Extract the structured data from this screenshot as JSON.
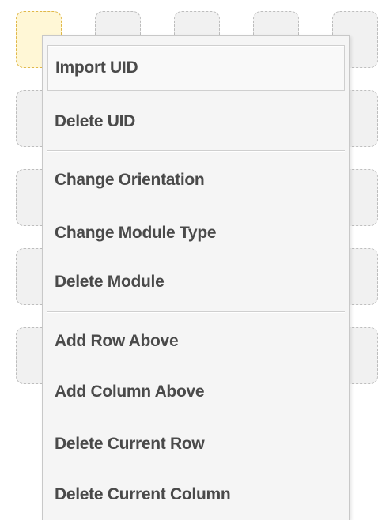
{
  "context_menu": {
    "items": [
      {
        "label": "Import UID"
      },
      {
        "label": "Delete UID"
      },
      {
        "label": "Change Orientation"
      },
      {
        "label": "Change Module Type"
      },
      {
        "label": "Delete Module"
      },
      {
        "label": "Add Row Above"
      },
      {
        "label": "Add Column Above"
      },
      {
        "label": "Delete Current Row"
      },
      {
        "label": "Delete Current Column"
      }
    ],
    "highlighted_item": "Import UID"
  },
  "colors": {
    "menu_text": "#4a4a4a",
    "menu_background": "#f5f5f5",
    "selected_module_fill": "#fff7d6",
    "selected_module_border": "#e0b84a",
    "module_fill": "#f1f1f1",
    "module_border": "#bdbdbd"
  }
}
